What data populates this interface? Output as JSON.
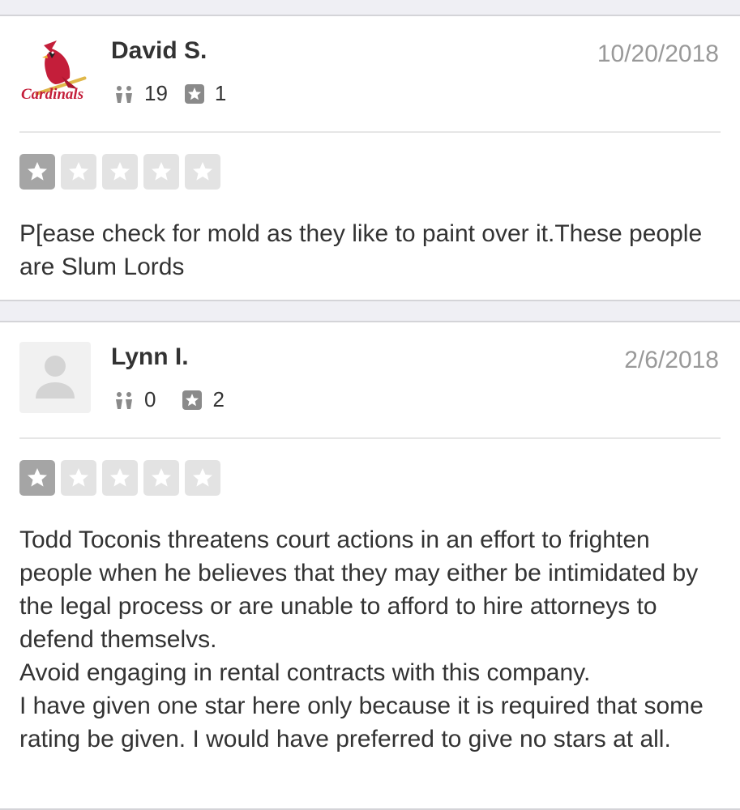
{
  "colors": {
    "page_background": "#efeff4",
    "card_background": "#ffffff",
    "star_filled": "#a5a5a5",
    "star_empty": "#e3e3e3",
    "date_text": "#999999",
    "icon_gray": "#8a8a8a",
    "cardinal_red": "#c41e3a"
  },
  "reviews": [
    {
      "user_name": "David S.",
      "date": "10/20/2018",
      "avatar_icon": "cardinals-logo-icon",
      "friends_count": "19",
      "reviews_count": "1",
      "rating": 1,
      "rating_max": 5,
      "text": "P[ease check for mold as they like to paint over it.These people are Slum Lords"
    },
    {
      "user_name": "Lynn I.",
      "date": "2/6/2018",
      "avatar_icon": "default-user-icon",
      "friends_count": "0",
      "reviews_count": "2",
      "rating": 1,
      "rating_max": 5,
      "text": "Todd Toconis threatens court actions in an effort to frighten people when he believes that they may either be intimidated by the legal process or are unable to afford to hire attorneys to defend themselvs.\nAvoid engaging in rental contracts with this company.\nI have given one star here only because it is required that some rating be given. I would have preferred to give no stars at all."
    }
  ]
}
